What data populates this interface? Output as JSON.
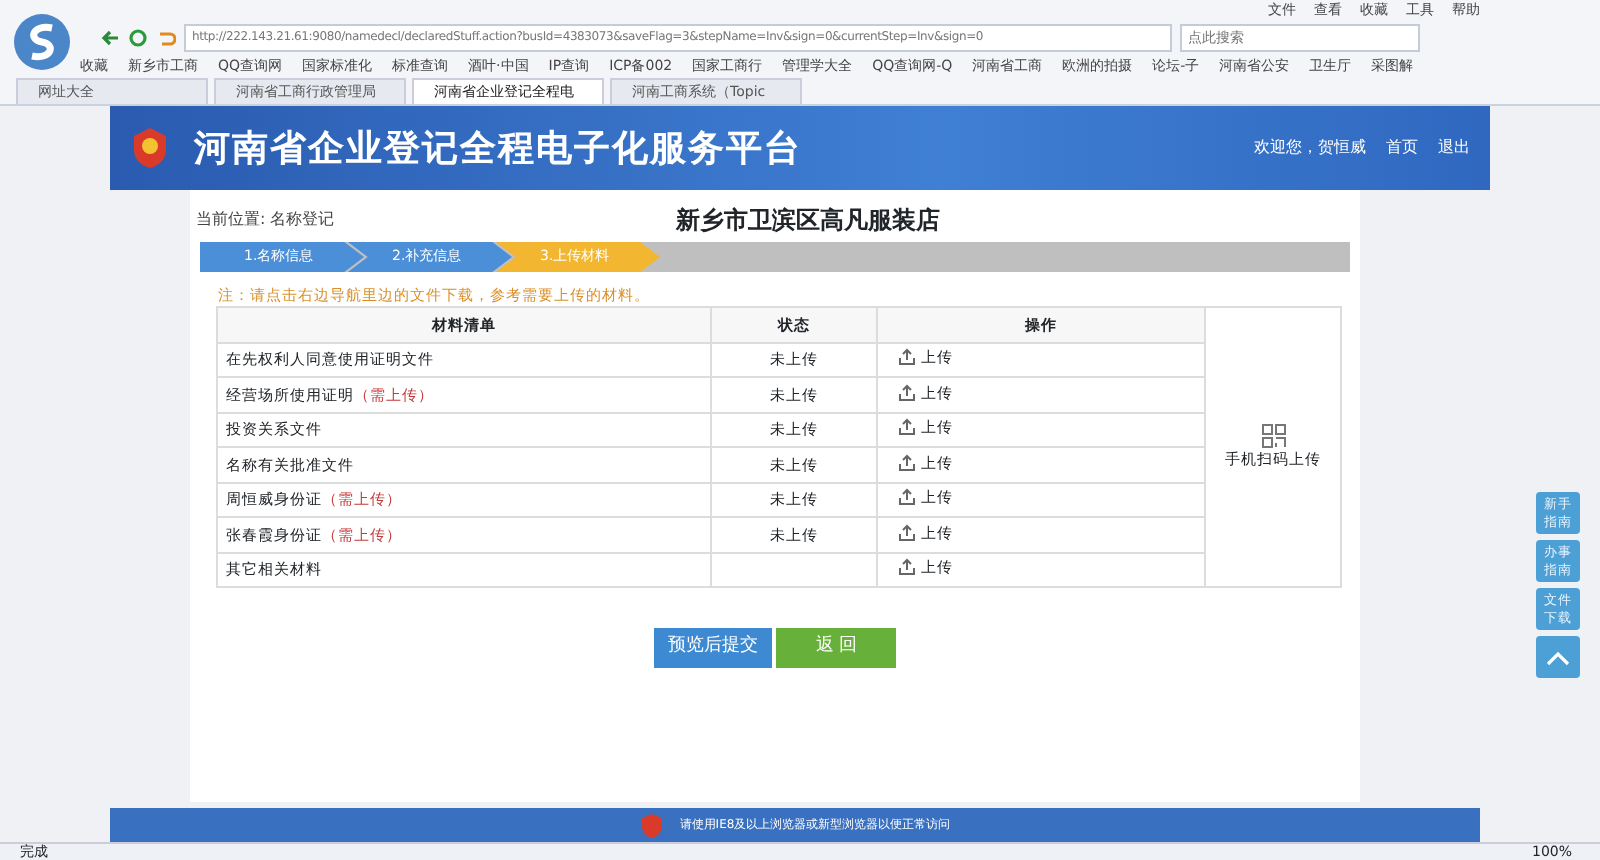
{
  "browser": {
    "menu": [
      "文件",
      "查看",
      "收藏",
      "工具",
      "帮助"
    ],
    "url": "http://222.143.21.61:9080/namedecl/declaredStuff.action?busId=4383073&saveFlag=3&stepName=Inv&sign=0&currentStep=Inv&sign=0",
    "search": {
      "placeholder": "点此搜索"
    },
    "bookmarks": [
      "收藏",
      "新乡市工商",
      "QQ查询网",
      "国家标准化",
      "标准查询",
      "酒叶·中国",
      "IP查询",
      "ICP备002",
      "国家工商行",
      "管理学大全",
      "QQ查询网-Q",
      "河南省工商",
      "欧洲的拍摄",
      "论坛-子",
      "河南省公安",
      "卫生厅",
      "采图解"
    ],
    "tabs": [
      {
        "label": "网址大全",
        "selected": false
      },
      {
        "label": "河南省工商行政管理局",
        "selected": false
      },
      {
        "label": "河南省企业登记全程电",
        "selected": true
      },
      {
        "label": "河南工商系统（Topic",
        "selected": false
      }
    ]
  },
  "header": {
    "title": "河南省企业登记全程电子化服务平台",
    "welcome": "欢迎您，贺恒威",
    "links": [
      "首页",
      "退出"
    ]
  },
  "location": "当前位置: 名称登记",
  "company": "新乡市卫滨区高凡服装店",
  "steps": [
    {
      "label": "1.名称信息",
      "selected": false
    },
    {
      "label": "2.补充信息",
      "selected": false
    },
    {
      "label": "3.上传材料",
      "selected": true
    }
  ],
  "note": "注：请点击右边导航里边的文件下载，参考需要上传的材料。",
  "table": {
    "columns": [
      "材料清单",
      "状态",
      "操作"
    ],
    "rows": [
      {
        "name": "在先权利人同意使用证明文件",
        "status": "未上传",
        "action": "上传"
      },
      {
        "name": "经营场所使用证明",
        "required_note": "（需上传）",
        "status": "未上传",
        "action": "上传"
      },
      {
        "name": "投资关系文件",
        "status": "未上传",
        "action": "上传"
      },
      {
        "name": "名称有关批准文件",
        "status": "未上传",
        "action": "上传"
      },
      {
        "name": "周恒威身份证",
        "required_note": "（需上传）",
        "status": "未上传",
        "action": "上传"
      },
      {
        "name": "张春霞身份证",
        "required_note": "（需上传）",
        "status": "未上传",
        "action": "上传"
      },
      {
        "name": "其它相关材料",
        "action": "上传"
      }
    ]
  },
  "qr_upload": "手机扫码上传",
  "side_buttons": [
    {
      "kind": "text",
      "label": "新手指南"
    },
    {
      "kind": "text",
      "label": "办事指南"
    },
    {
      "kind": "text",
      "label": "文件下载"
    },
    {
      "kind": "up"
    }
  ],
  "buttons": [
    {
      "kind": "primary",
      "label": "预览后提交"
    },
    {
      "kind": "success",
      "label": "返 回"
    }
  ],
  "footer": "请使用IE8及以上浏览器或新型浏览器以便正常访问",
  "status_bar": {
    "text": "完成",
    "zoom": "100%"
  }
}
